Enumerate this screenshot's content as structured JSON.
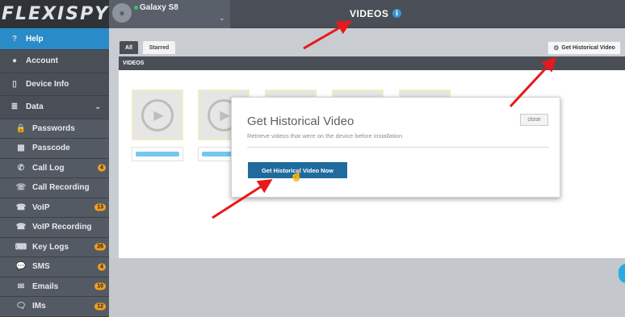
{
  "brand": {
    "logo_text": "FLEXISPY"
  },
  "sidebar": {
    "items": [
      {
        "label": "Help",
        "icon": "help-icon",
        "glyph": "?"
      },
      {
        "label": "Account",
        "icon": "user-icon",
        "glyph": "●"
      },
      {
        "label": "Device Info",
        "icon": "phone-icon",
        "glyph": "▯"
      },
      {
        "label": "Data",
        "icon": "database-icon",
        "glyph": "≣"
      }
    ],
    "sub_items": [
      {
        "label": "Passwords",
        "icon": "lock-icon",
        "glyph": "🔒",
        "badge": ""
      },
      {
        "label": "Passcode",
        "icon": "grid-icon",
        "glyph": "▦",
        "badge": ""
      },
      {
        "label": "Call Log",
        "icon": "phone-call-icon",
        "glyph": "✆",
        "badge": "4"
      },
      {
        "label": "Call Recording",
        "icon": "call-recording-icon",
        "glyph": "☏",
        "badge": ""
      },
      {
        "label": "VoIP",
        "icon": "voip-icon",
        "glyph": "☎",
        "badge": "13"
      },
      {
        "label": "VoIP Recording",
        "icon": "voip-recording-icon",
        "glyph": "☎",
        "badge": ""
      },
      {
        "label": "Key Logs",
        "icon": "keyboard-icon",
        "glyph": "⌨",
        "badge": "26"
      },
      {
        "label": "SMS",
        "icon": "chat-icon",
        "glyph": "💬",
        "badge": "4"
      },
      {
        "label": "Emails",
        "icon": "mail-icon",
        "glyph": "✉",
        "badge": "10"
      },
      {
        "label": "IMs",
        "icon": "im-icon",
        "glyph": "🗨",
        "badge": "12"
      }
    ]
  },
  "header": {
    "device_name": "Galaxy S8",
    "title": "VIDEOS"
  },
  "tabs": {
    "all": "All",
    "starred": "Starred"
  },
  "toolbar": {
    "historical_btn": "Get Historical Video"
  },
  "panel": {
    "header": "VIDEOS"
  },
  "modal": {
    "title": "Get Historical Video",
    "subtitle": "Retrieve videos that were on the device before installation",
    "close": "close",
    "action": "Get Historical Video Now"
  },
  "colors": {
    "accent": "#2a8bc9",
    "sidebar": "#4a4f57",
    "badge": "#f0a020",
    "primary_button": "#1f6b9e",
    "annotation_arrow": "#e8191a"
  }
}
